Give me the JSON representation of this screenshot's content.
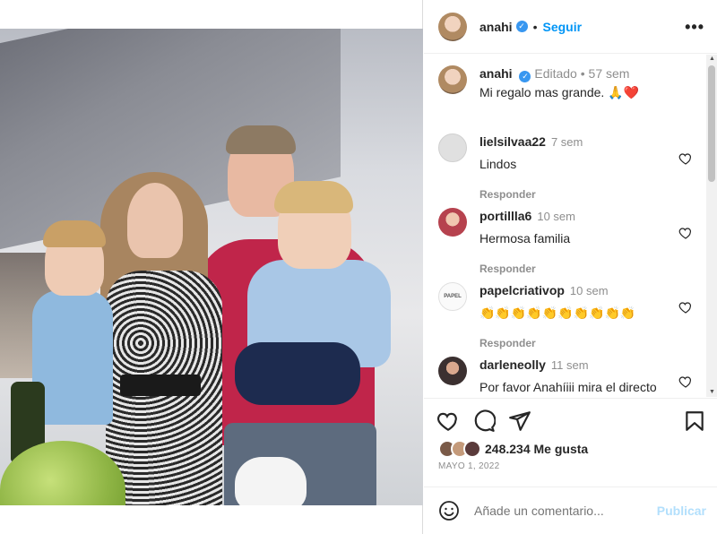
{
  "post": {
    "username": "anahi",
    "follow_label": "Seguir",
    "more_label": "•••",
    "caption": {
      "username": "anahi",
      "edited": "Editado",
      "time": "57 sem",
      "text": "Mi regalo mas grande. 🙏❤️"
    },
    "comments": [
      {
        "username": "lielsilvaa22",
        "time": "7 sem",
        "text": "Lindos",
        "reply": "Responder",
        "avatar_color": "#e4e4e4"
      },
      {
        "username": "portillla6",
        "time": "10 sem",
        "text": "Hermosa familia",
        "reply": "Responder",
        "avatar_color": "#b6424e"
      },
      {
        "username": "papelcriativop",
        "time": "10 sem",
        "text": "👏👏👏👏👏👏👏👏👏👏",
        "reply": "Responder",
        "avatar_color": "#f2f2f2"
      },
      {
        "username": "darleneolly",
        "time": "11 sem",
        "text": "Por favor Anahíiii mira el directo",
        "reply": "",
        "avatar_color": "#3b3030"
      }
    ],
    "likes": "248.234 Me gusta",
    "date": "MAYO 1, 2022",
    "add_comment_placeholder": "Añade un comentario...",
    "publish_label": "Publicar"
  },
  "colors": {
    "accent": "#0095f6",
    "verified": "#3897f0",
    "muted": "#8e8e8e"
  }
}
